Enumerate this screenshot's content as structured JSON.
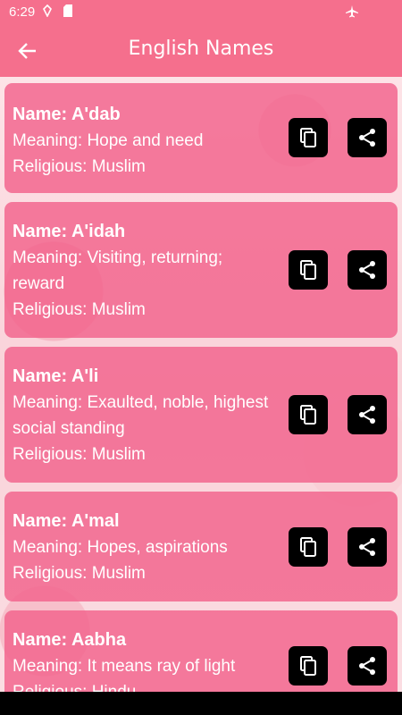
{
  "status_bar": {
    "time": "6:29"
  },
  "app_bar": {
    "title": "English Names"
  },
  "names": [
    {
      "name": "Name: A'dab",
      "meaning": "Meaning: Hope and need",
      "religious": "Religious: Muslim"
    },
    {
      "name": "Name: A'idah",
      "meaning": "Meaning: Visiting, returning; reward",
      "religious": "Religious: Muslim"
    },
    {
      "name": "Name: A'li",
      "meaning": "Meaning: Exaulted, noble, highest social standing",
      "religious": "Religious: Muslim"
    },
    {
      "name": "Name: A'mal",
      "meaning": "Meaning: Hopes, aspirations",
      "religious": "Religious: Muslim"
    },
    {
      "name": "Name: Aabha",
      "meaning": "Meaning: It means ray of light",
      "religious": "Religious: Hindu"
    }
  ],
  "icons": {
    "back": "arrow-back-icon",
    "copy": "copy-icon",
    "share": "share-icon"
  },
  "colors": {
    "accent": "#f56f8d",
    "card": "#f1618b",
    "button": "#000000"
  }
}
